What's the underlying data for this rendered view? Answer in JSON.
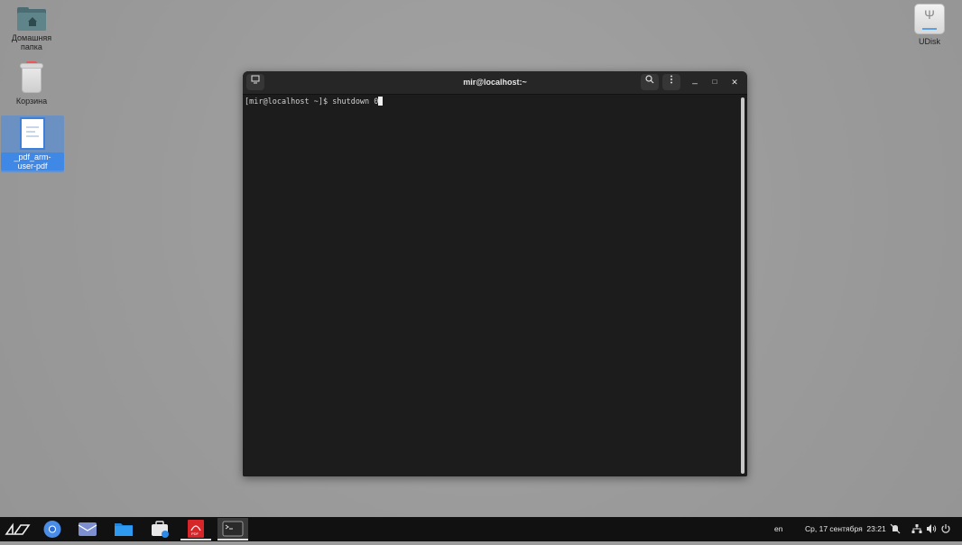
{
  "desktop": {
    "icons": [
      {
        "label": "Домашняя папка"
      },
      {
        "label": "Корзина"
      },
      {
        "label": "_pdf_arm-user-pdf"
      },
      {
        "label": "UDisk"
      }
    ]
  },
  "terminal": {
    "title": "mir@localhost:~",
    "prompt_line": "[mir@localhost ~]$ shutdown 0",
    "buttons": {
      "minimize": "_",
      "maximize": "□",
      "close": "✕"
    }
  },
  "taskbar": {
    "apps": [
      "start-menu",
      "chromium",
      "mail",
      "file-manager",
      "app-store",
      "pdf-viewer",
      "terminal"
    ],
    "pdf_badge": "PDF",
    "language": "en",
    "datetime": "Ср, 17 сентября  23:21"
  },
  "colors": {
    "selection": "#3f88e5",
    "terminal_bg": "#1c1c1c",
    "taskbar_bg": "#111111"
  }
}
